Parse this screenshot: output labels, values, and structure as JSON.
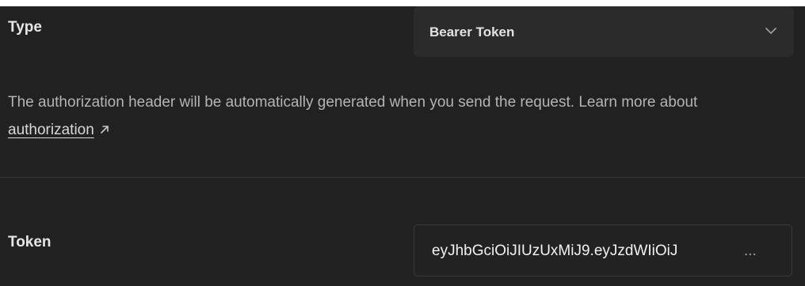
{
  "auth": {
    "type_label": "Type",
    "type_value": "Bearer Token",
    "help_text_before_link": "The authorization header will be automatically generated when you send the request. Learn more about ",
    "help_link_label": "authorization",
    "token_label": "Token",
    "token_value": "eyJhbGciOiJIUzUxMiJ9.eyJzdWIiOiJ",
    "token_ellipsis": "..."
  },
  "icons": {
    "select_icon": "chevron-down-icon",
    "link_icon": "external-link-icon"
  },
  "colors": {
    "background": "#212121",
    "field_background": "#2b2b2b"
  }
}
